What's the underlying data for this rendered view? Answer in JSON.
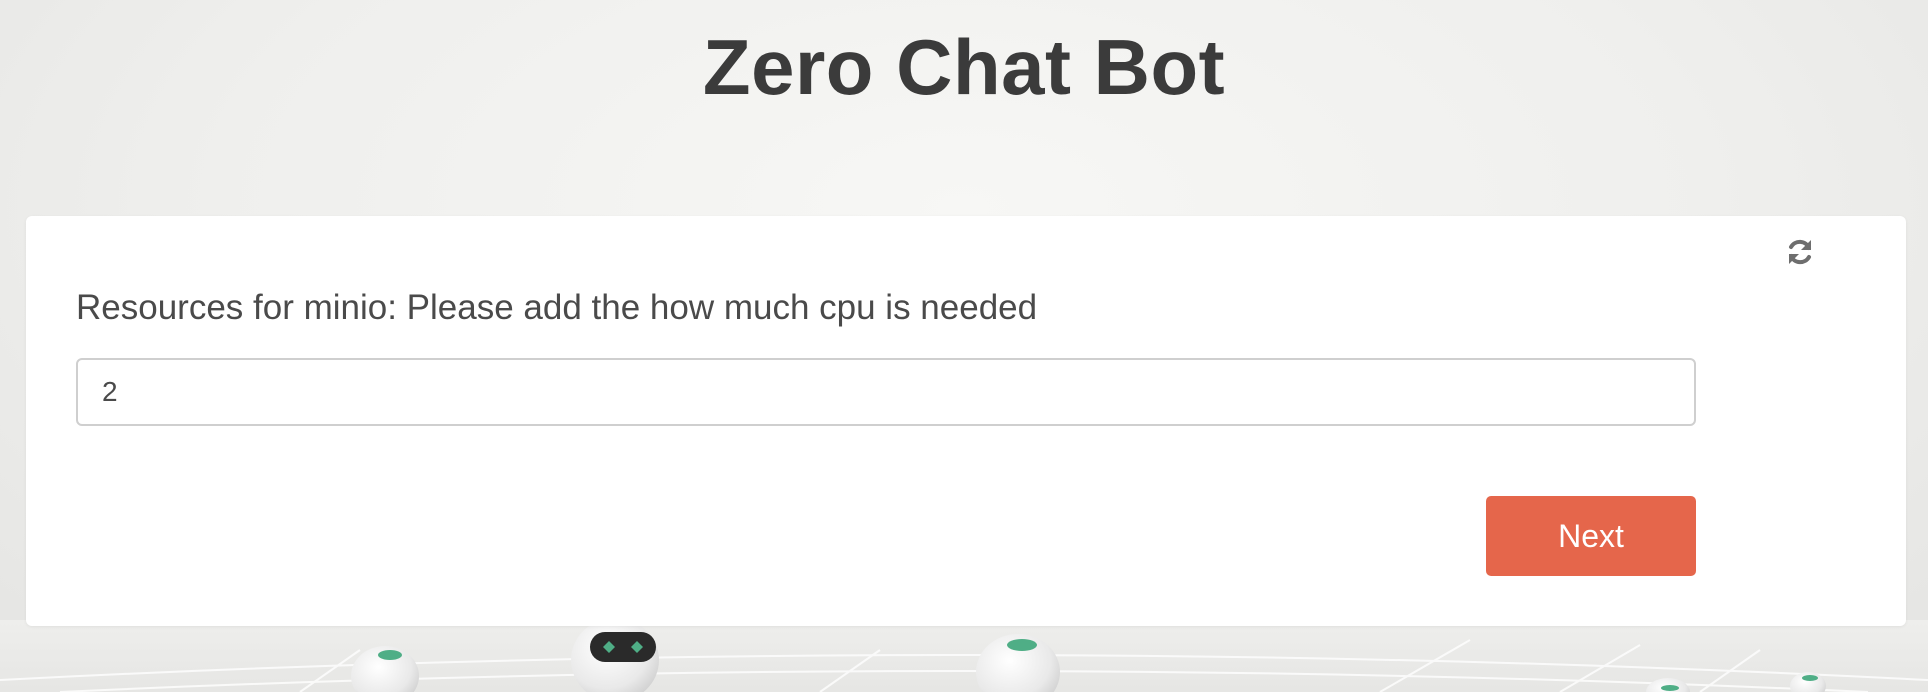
{
  "header": {
    "title": "Zero Chat Bot"
  },
  "form": {
    "question": "Resources for minio: Please add the how much cpu is needed",
    "input_value": "2",
    "next_label": "Next"
  },
  "icons": {
    "refresh": "refresh-icon"
  },
  "colors": {
    "accent": "#e5664b",
    "title": "#3b3b3b",
    "text": "#4a4a4a",
    "robot_eye": "#4fae86"
  }
}
